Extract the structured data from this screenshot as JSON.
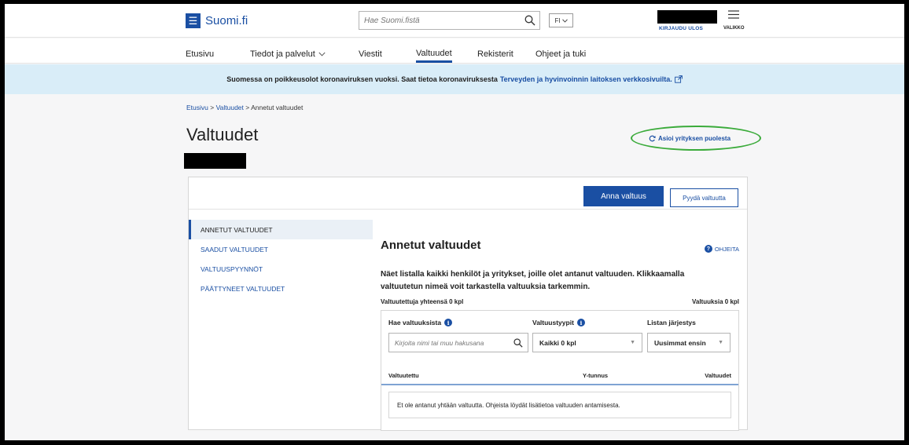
{
  "header": {
    "logo_mark": "☰",
    "logo_text": "Suomi.fi",
    "search_placeholder": "Hae Suomi.fistä",
    "search_icon": "search-icon",
    "language": "FI",
    "logout_label": "KIRJAUDU ULOS",
    "menu_label": "VALIKKO",
    "menu_icon": "hamburger-icon"
  },
  "nav": {
    "items": [
      {
        "label": "Etusivu"
      },
      {
        "label": "Tiedot ja palvelut"
      },
      {
        "label": "Viestit"
      },
      {
        "label": "Valtuudet"
      },
      {
        "label": "Rekisterit"
      },
      {
        "label": "Ohjeet ja tuki"
      }
    ],
    "active": "Valtuudet"
  },
  "notice": {
    "text": "Suomessa on poikkeusolot koronaviruksen vuoksi. Saat tietoa koronaviruksesta",
    "link": "Terveyden ja hyvinvoinnin laitoksen verkkosivuilta."
  },
  "breadcrumb": {
    "home": "Etusivu",
    "sep1": ">",
    "section": "Valtuudet",
    "sep2": ">",
    "current": "Annetut valtuudet"
  },
  "page": {
    "title": "Valtuudet",
    "act_on_behalf": "Asioi yrityksen puolesta"
  },
  "toolbar": {
    "grant_label": "Anna valtuus",
    "request_label": "Pyydä valtuutta"
  },
  "sidenav": {
    "items": [
      {
        "label": "ANNETUT VALTUUDET"
      },
      {
        "label": "SAADUT VALTUUDET"
      },
      {
        "label": "VALTUUSPYYNNÖT"
      },
      {
        "label": "PÄÄTTYNEET VALTUUDET"
      }
    ]
  },
  "content": {
    "title": "Annetut valtuudet",
    "help": "OHJEITA",
    "description": "Näet listalla kaikki henkilöt ja yritykset, joille olet antanut valtuuden. Klikkaamalla valtuutetun nimeä voit tarkastella valtuuksia tarkemmin.",
    "count_left": "Valtuutettuja yhteensä 0 kpl",
    "count_right": "Valtuuksia 0 kpl"
  },
  "filters": {
    "search_label": "Hae valtuuksista",
    "search_placeholder": "Kirjoita nimi tai muu hakusana",
    "types_label": "Valtuustyypit",
    "types_value": "Kaikki 0 kpl",
    "order_label": "Listan järjestys",
    "order_value": "Uusimmat ensin"
  },
  "table": {
    "columns": [
      "Valtuutettu",
      "Y-tunnus",
      "Valtuudet"
    ],
    "empty_text": "Et ole antanut yhtään valtuutta. Ohjeista löydät lisätietoa valtuuden antamisesta."
  },
  "colors": {
    "brand": "#1a4fa3",
    "notice_bg": "#d9edf8",
    "highlight_ring": "#3bab3b"
  }
}
